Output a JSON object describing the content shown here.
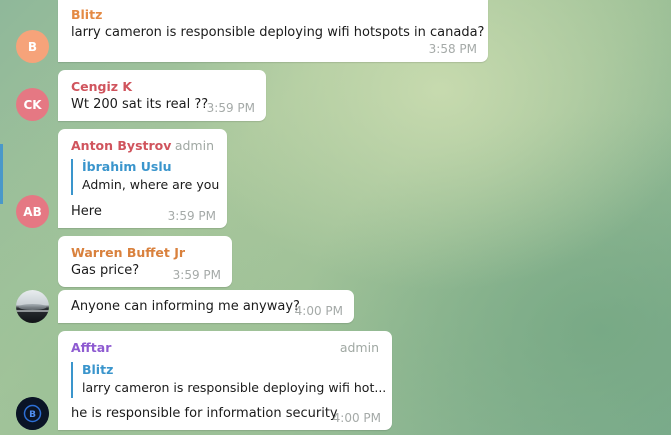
{
  "messages": [
    {
      "sender": "Blitz",
      "sender_color": "#e48a44",
      "avatar_initials": "B",
      "avatar_color": "#f6a37a",
      "text": "larry cameron is responsible deploying wifi hotspots in canada?",
      "time": "3:58 PM"
    },
    {
      "sender": "Cengiz K",
      "sender_color": "#d0545d",
      "avatar_initials": "CK",
      "avatar_color": "#e57883",
      "text": "Wt 200 sat its real ??",
      "time": "3:59 PM"
    },
    {
      "sender": "Anton Bystrov",
      "sender_color": "#d0545d",
      "role": "admin",
      "avatar_initials": "AB",
      "avatar_color": "#e57883",
      "reply_to": {
        "name": "İbrahim Uslu",
        "text": "Admin, where are you"
      },
      "text": "Here",
      "time": "3:59 PM"
    },
    {
      "sender": "Warren Buffet Jr",
      "sender_color": "#d9813d",
      "text": "Gas price?",
      "time": "3:59 PM"
    },
    {
      "avatar_icon": "landscape-photo-avatar",
      "text": "Anyone can informing me anyway?",
      "time": "4:00 PM"
    },
    {
      "sender": "Afftar",
      "sender_color": "#8e5bd1",
      "role": "admin",
      "avatar_icon": "dark-blue-logo-avatar",
      "reply_to": {
        "name": "Blitz",
        "text": "larry cameron is responsible deploying wifi hot..."
      },
      "text": "he is responsible for information security",
      "time": "4:00 PM"
    }
  ]
}
